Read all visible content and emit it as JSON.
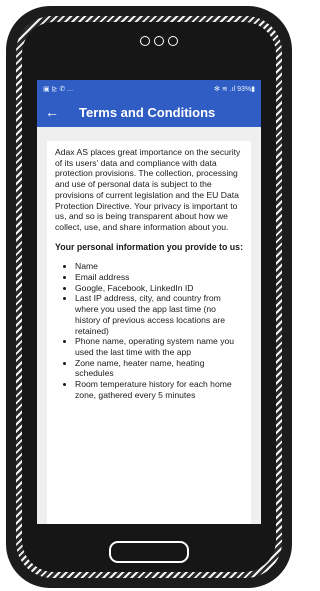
{
  "statusbar": {
    "left_icons": "▣ ⊵ ✆ ...",
    "right_text": "✻ ≋ .ıl 93%▮"
  },
  "appbar": {
    "back_icon": "←",
    "title": "Terms and Conditions"
  },
  "content": {
    "intro": "Adax AS places great importance on the security of its users' data and compliance with data protection provisions. The collection, processing and use of personal data is subject to the provisions of current legislation and the EU Data Protection Directive. Your privacy is important to us, and so is being transparent about how we collect, use, and share information about you.",
    "heading": "Your personal information you provide to us:",
    "items": [
      "Name",
      "Email address",
      "Google, Facebook, LinkedIn ID",
      "Last IP address, city, and country from where you used the app last time (no history of previous access locations are retained)",
      "Phone name, operating system name you used the last time with the app",
      "Zone name, heater name, heating schedules",
      "Room temperature history for each home zone, gathered every 5 minutes"
    ]
  },
  "colors": {
    "appbar": "#2f5dc4",
    "screen_bg": "#efefef",
    "frame": "#1c1c1c"
  }
}
